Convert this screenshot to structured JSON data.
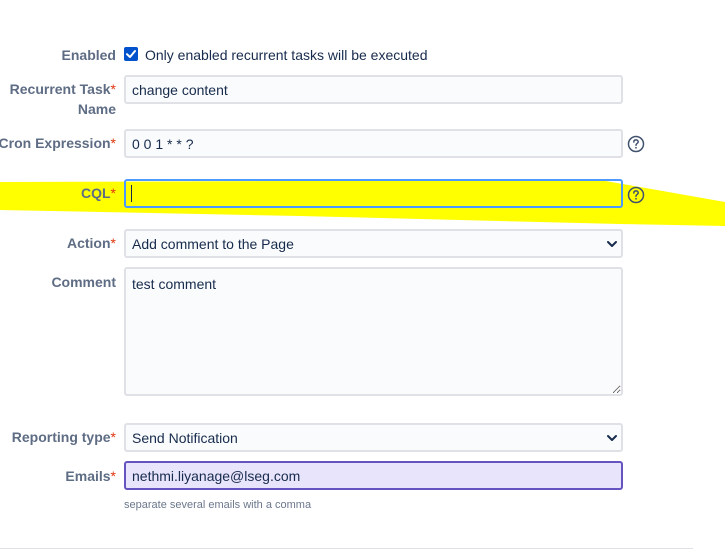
{
  "form": {
    "enabled": {
      "label": "Enabled",
      "checked": true,
      "description": "Only enabled recurrent tasks will be executed"
    },
    "task_name": {
      "label_line1": "Recurrent Task",
      "label_line2": "Name",
      "required_mark": "*",
      "value": "change content"
    },
    "cron": {
      "label": "Cron Expression",
      "required_mark": "*",
      "value": "0 0 1 * * ?"
    },
    "cql": {
      "label": "CQL",
      "required_mark": "*",
      "value": ""
    },
    "action": {
      "label": "Action",
      "required_mark": "*",
      "selected": "Add comment to the Page"
    },
    "comment": {
      "label": "Comment",
      "value": "test comment"
    },
    "reporting_type": {
      "label": "Reporting type",
      "required_mark": "*",
      "selected": "Send Notification"
    },
    "emails": {
      "label": "Emails",
      "required_mark": "*",
      "value": "nethmi.liyanage@lseg.com",
      "hint": "separate several emails with a comma"
    }
  },
  "colors": {
    "accent": "#0052cc",
    "required": "#de350b",
    "label": "#5e6c84",
    "highlighter": "#ffff00"
  },
  "icons": {
    "help": "question-circle-icon",
    "checkbox": "checkbox-checked-icon",
    "select": "chevron-down-icon"
  }
}
